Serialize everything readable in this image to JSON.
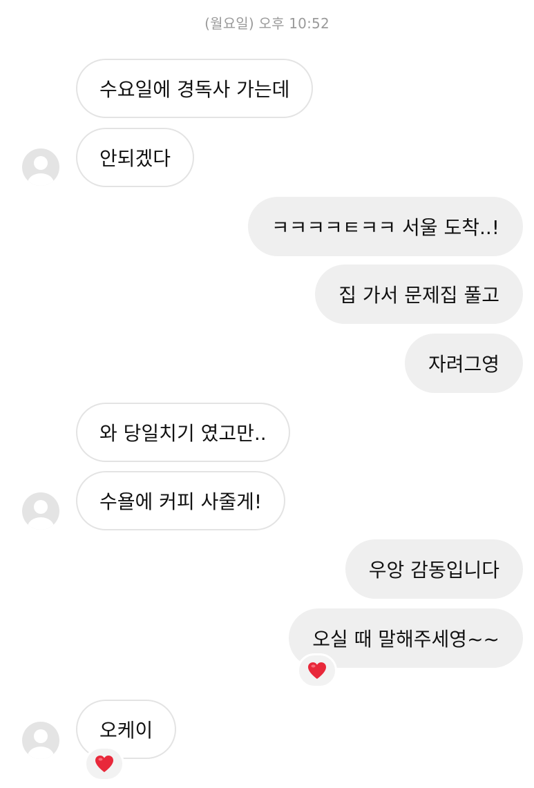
{
  "timestamp": "(월요일) 오후 10:52",
  "colors": {
    "incoming_bubble_bg": "#ffffff",
    "incoming_bubble_border": "#e3e3e3",
    "outgoing_bubble_bg": "#efefef",
    "timestamp_text": "#9a9a9a",
    "reaction_heart": "#e8283a"
  },
  "messages": [
    {
      "side": "incoming",
      "text": "수요일에 경독사 가는데"
    },
    {
      "side": "incoming",
      "text": "안되겠다",
      "avatar": "default-profile-icon"
    },
    {
      "side": "outgoing",
      "text": "ㅋㅋㅋㅋㅌㅋㅋ 서울 도착..!"
    },
    {
      "side": "outgoing",
      "text": "집 가서 문제집 풀고"
    },
    {
      "side": "outgoing",
      "text": "자려그영"
    },
    {
      "side": "incoming",
      "text": "와 당일치기 였고만.."
    },
    {
      "side": "incoming",
      "text": "수욜에 커피 사줄게!",
      "avatar": "default-profile-icon"
    },
    {
      "side": "outgoing",
      "text": "우앙 감동입니다"
    },
    {
      "side": "outgoing",
      "text": "오실 때 말해주세영~~",
      "reaction": "heart-icon"
    },
    {
      "side": "incoming",
      "text": "오케이",
      "avatar": "default-profile-icon",
      "reaction": "heart-icon"
    }
  ]
}
